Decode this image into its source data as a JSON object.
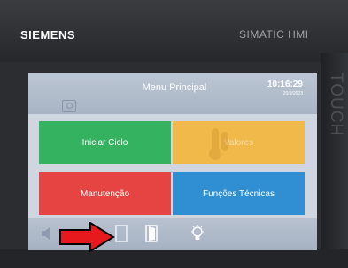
{
  "device": {
    "brand": "SIEMENS",
    "model": "SIMATIC HMI",
    "side_label": "TOUCH"
  },
  "header": {
    "title": "Menu Principal",
    "time": "10:16:29",
    "date": "20/9/2023"
  },
  "tiles": [
    {
      "label": "Iniciar Ciclo",
      "color": "#34b25f"
    },
    {
      "label": "Valores",
      "color": "#f1b84a"
    },
    {
      "label": "Manutenção",
      "color": "#e64343"
    },
    {
      "label": "Funções Técnicas",
      "color": "#2f8fd2"
    }
  ],
  "footer": {
    "icons": [
      "speaker-icon",
      "door-closed-icon",
      "door-open-icon",
      "light-bulb-icon"
    ]
  },
  "annotation": {
    "arrow_color": "#e8191c"
  }
}
